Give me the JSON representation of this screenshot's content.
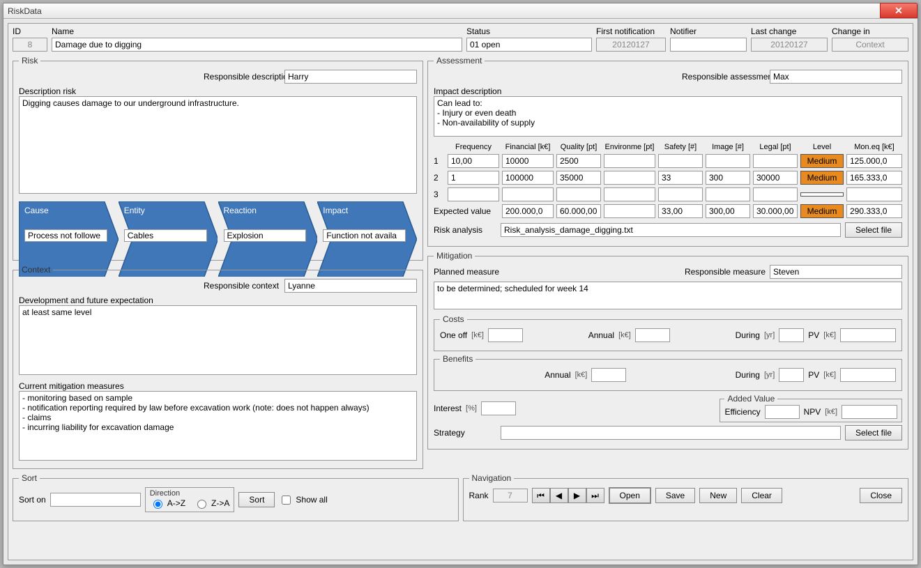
{
  "window_title": "RiskData",
  "top": {
    "id_label": "ID",
    "id_value": "8",
    "name_label": "Name",
    "name_value": "Damage due to digging",
    "status_label": "Status",
    "status_value": "01 open",
    "firstnot_label": "First notification",
    "firstnot_value": "20120127",
    "notifier_label": "Notifier",
    "notifier_value": "",
    "lastchange_label": "Last change",
    "lastchange_value": "20120127",
    "changein_label": "Change in",
    "changein_value": "Context"
  },
  "risk": {
    "legend": "Risk",
    "resp_label": "Responsible description",
    "resp_value": "Harry",
    "desc_label": "Description risk",
    "desc_value": "Digging causes damage to our underground infrastructure.",
    "chev": {
      "cause_label": "Cause",
      "cause_value": "Process not followe",
      "entity_label": "Entity",
      "entity_value": "Cables",
      "reaction_label": "Reaction",
      "reaction_value": "Explosion",
      "impact_label": "Impact",
      "impact_value": "Function not availa"
    }
  },
  "context": {
    "legend": "Context",
    "resp_label": "Responsible context",
    "resp_value": "Lyanne",
    "dev_label": "Development and future expectation",
    "dev_value": "at least same level",
    "mit_label": "Current mitigation measures",
    "mit_value": "- monitoring based on sample\n- notification reporting required by law before excavation work (note: does not happen always)\n- claims\n- incurring liability for excavation damage"
  },
  "assessment": {
    "legend": "Assessment",
    "resp_label": "Responsible assessment",
    "resp_value": "Max",
    "impact_label": "Impact description",
    "impact_value": "Can lead to:\n- Injury or even death\n- Non-availability of supply",
    "hdrs": {
      "freq": "Frequency",
      "fin": "Financial [k€]",
      "qual": "Quality [pt]",
      "env": "Environme [pt]",
      "saf": "Safety [#]",
      "img": "Image [#]",
      "leg": "Legal [pt]",
      "lvl": "Level",
      "mon": "Mon.eq [k€]"
    },
    "rows": [
      {
        "n": "1",
        "freq": "10,00",
        "fin": "10000",
        "qual": "2500",
        "env": "",
        "saf": "",
        "img": "",
        "leg": "",
        "lvl": "Medium",
        "mon": "125.000,0"
      },
      {
        "n": "2",
        "freq": "1",
        "fin": "100000",
        "qual": "35000",
        "env": "",
        "saf": "33",
        "img": "300",
        "leg": "30000",
        "lvl": "Medium",
        "mon": "165.333,0"
      },
      {
        "n": "3",
        "freq": "",
        "fin": "",
        "qual": "",
        "env": "",
        "saf": "",
        "img": "",
        "leg": "",
        "lvl": "",
        "mon": ""
      }
    ],
    "exp_label": "Expected value",
    "exp": {
      "fin": "200.000,0",
      "qual": "60.000,00",
      "env": "",
      "saf": "33,00",
      "img": "300,00",
      "leg": "30.000,00",
      "lvl": "Medium",
      "mon": "290.333,0"
    },
    "ra_label": "Risk analysis",
    "ra_value": "Risk_analysis_damage_digging.txt",
    "selectfile": "Select file"
  },
  "mitigation": {
    "legend": "Mitigation",
    "resp_label": "Responsible measure",
    "resp_value": "Steven",
    "plan_label": "Planned measure",
    "plan_value": "to be determined; scheduled for week 14",
    "costs_legend": "Costs",
    "oneoff": "One off",
    "annual": "Annual",
    "during": "During",
    "pv": "PV",
    "ke": "[k€]",
    "yr": "[yr]",
    "benefits_legend": "Benefits",
    "interest": "Interest",
    "pct": "[%]",
    "added_legend": "Added Value",
    "efficiency": "Efficiency",
    "npv": "NPV",
    "strategy": "Strategy",
    "selectfile": "Select file"
  },
  "sort": {
    "legend": "Sort",
    "sorton": "Sort on",
    "dir_legend": "Direction",
    "az": "A->Z",
    "za": "Z->A",
    "sortbtn": "Sort",
    "showall": "Show all"
  },
  "nav": {
    "legend": "Navigation",
    "rank": "Rank",
    "rank_value": "7",
    "open": "Open",
    "save": "Save",
    "new": "New",
    "clear": "Clear",
    "close": "Close"
  }
}
